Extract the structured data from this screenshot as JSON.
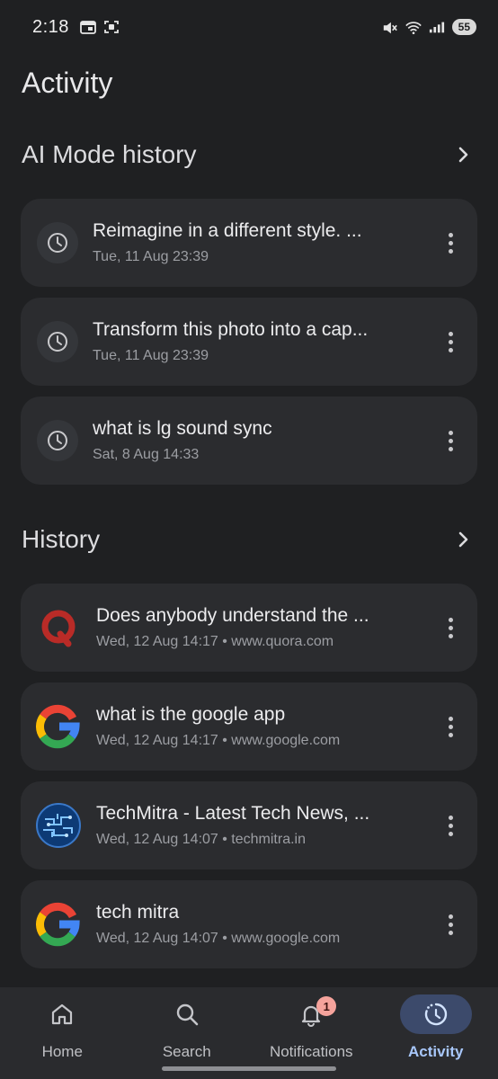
{
  "status_bar": {
    "time": "2:18",
    "battery": "55"
  },
  "page": {
    "title": "Activity"
  },
  "ai_mode": {
    "title": "AI Mode history",
    "items": [
      {
        "title": "Reimagine in a different style. ...",
        "subtitle": "Tue, 11 Aug 23:39"
      },
      {
        "title": "Transform this photo into a cap...",
        "subtitle": "Tue, 11 Aug 23:39"
      },
      {
        "title": "what is lg sound sync",
        "subtitle": "Sat, 8 Aug 14:33"
      }
    ]
  },
  "history": {
    "title": "History",
    "items": [
      {
        "icon": "quora-icon",
        "title": "Does anybody understand the ...",
        "subtitle": "Wed, 12 Aug 14:17 • www.quora.com"
      },
      {
        "icon": "google-icon",
        "title": "what is the google app",
        "subtitle": "Wed, 12 Aug 14:17 • www.google.com"
      },
      {
        "icon": "techmitra-icon",
        "title": "TechMitra - Latest Tech News, ...",
        "subtitle": "Wed, 12 Aug 14:07 • techmitra.in"
      },
      {
        "icon": "google-icon",
        "title": "tech mitra",
        "subtitle": "Wed, 12 Aug 14:07 • www.google.com"
      }
    ]
  },
  "bottom_nav": {
    "items": [
      {
        "label": "Home",
        "icon": "home-icon"
      },
      {
        "label": "Search",
        "icon": "search-icon"
      },
      {
        "label": "Notifications",
        "icon": "bell-icon",
        "badge": "1"
      },
      {
        "label": "Activity",
        "icon": "activity-icon",
        "active": true
      }
    ]
  },
  "colors": {
    "background": "#1f2022",
    "card": "#2b2c2f",
    "active_nav": "#3c4a6b",
    "accent": "#a8c7fa",
    "badge": "#f5a39c"
  }
}
